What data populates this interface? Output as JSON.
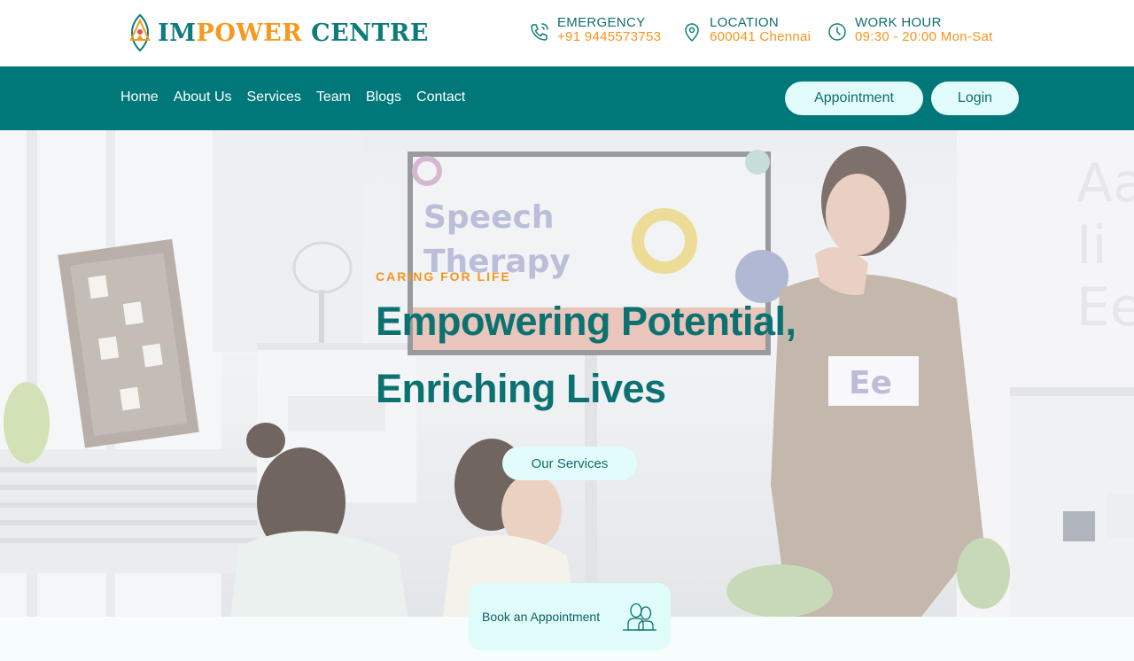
{
  "brand": {
    "logo_part1": "IM",
    "logo_part2": "POWER",
    "logo_part3": "CENTRE",
    "primary_color": "#00787a",
    "accent_color": "#f5941d"
  },
  "header": {
    "emergency": {
      "icon": "phone-icon",
      "title": "EMERGENCY",
      "value": "+91 9445573753"
    },
    "location": {
      "icon": "map-pin-icon",
      "title": "LOCATION",
      "value": "600041 Chennai"
    },
    "work_hour": {
      "icon": "clock-icon",
      "title": "WORK HOUR",
      "value": "09:30 - 20:00 Mon-Sat"
    }
  },
  "nav": {
    "links": [
      "Home",
      "About Us",
      "Services",
      "Team",
      "Blogs",
      "Contact"
    ],
    "appointment_label": "Appointment",
    "login_label": "Login"
  },
  "hero": {
    "kicker": "CARING FOR LIFE",
    "headline_line1": "Empowering Potential,",
    "headline_line2": "Enriching Lives",
    "cta_label": "Our Services"
  },
  "booking": {
    "label": "Book an Appointment",
    "icon": "people-icon"
  }
}
